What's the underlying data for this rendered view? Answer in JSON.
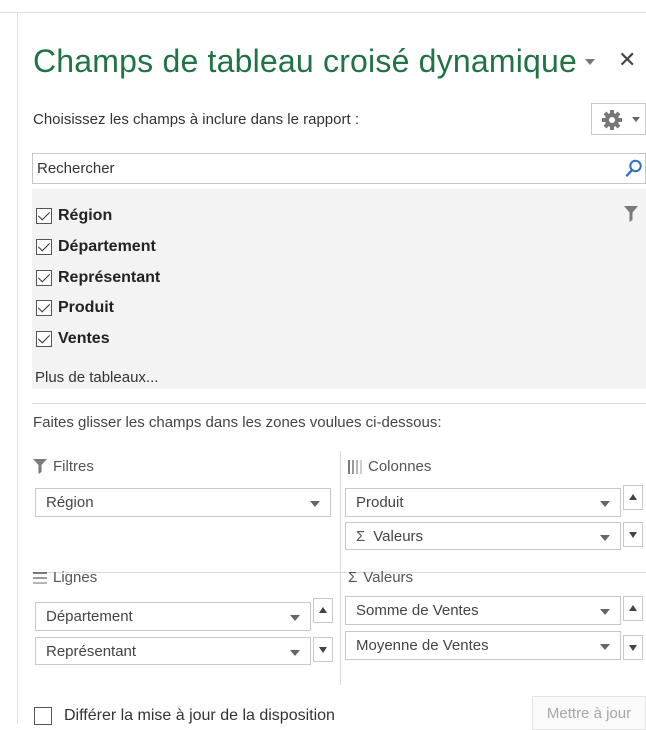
{
  "panel": {
    "title": "Champs de tableau croisé dynamique",
    "subtitle": "Choisissez les champs à inclure dans le rapport :"
  },
  "search": {
    "placeholder": "Rechercher",
    "value": ""
  },
  "fields": [
    {
      "label": "Région",
      "checked": true
    },
    {
      "label": "Département",
      "checked": true
    },
    {
      "label": "Représentant",
      "checked": true
    },
    {
      "label": "Produit",
      "checked": true
    },
    {
      "label": "Ventes",
      "checked": true
    }
  ],
  "more_tables": "Plus de tableaux...",
  "drag_instruction": "Faites glisser les champs dans les zones voulues ci-dessous:",
  "areas": {
    "filters": {
      "label": "Filtres",
      "items": [
        "Région"
      ]
    },
    "columns": {
      "label": "Colonnes",
      "items": [
        "Produit",
        "Valeurs"
      ]
    },
    "rows": {
      "label": "Lignes",
      "items": [
        "Département",
        "Représentant"
      ]
    },
    "values": {
      "label": "Valeurs",
      "items": [
        "Somme de Ventes",
        "Moyenne de Ventes"
      ]
    }
  },
  "footer": {
    "defer_label": "Différer la mise à jour de la disposition",
    "defer_checked": false,
    "update_button": "Mettre à jour"
  },
  "icons": {
    "close": "close-icon",
    "gear": "gear-icon",
    "search": "search-icon",
    "filter": "filter-icon",
    "sigma": "Σ"
  },
  "colors": {
    "title": "#217346",
    "field_list_bg": "#f3f3f3"
  }
}
